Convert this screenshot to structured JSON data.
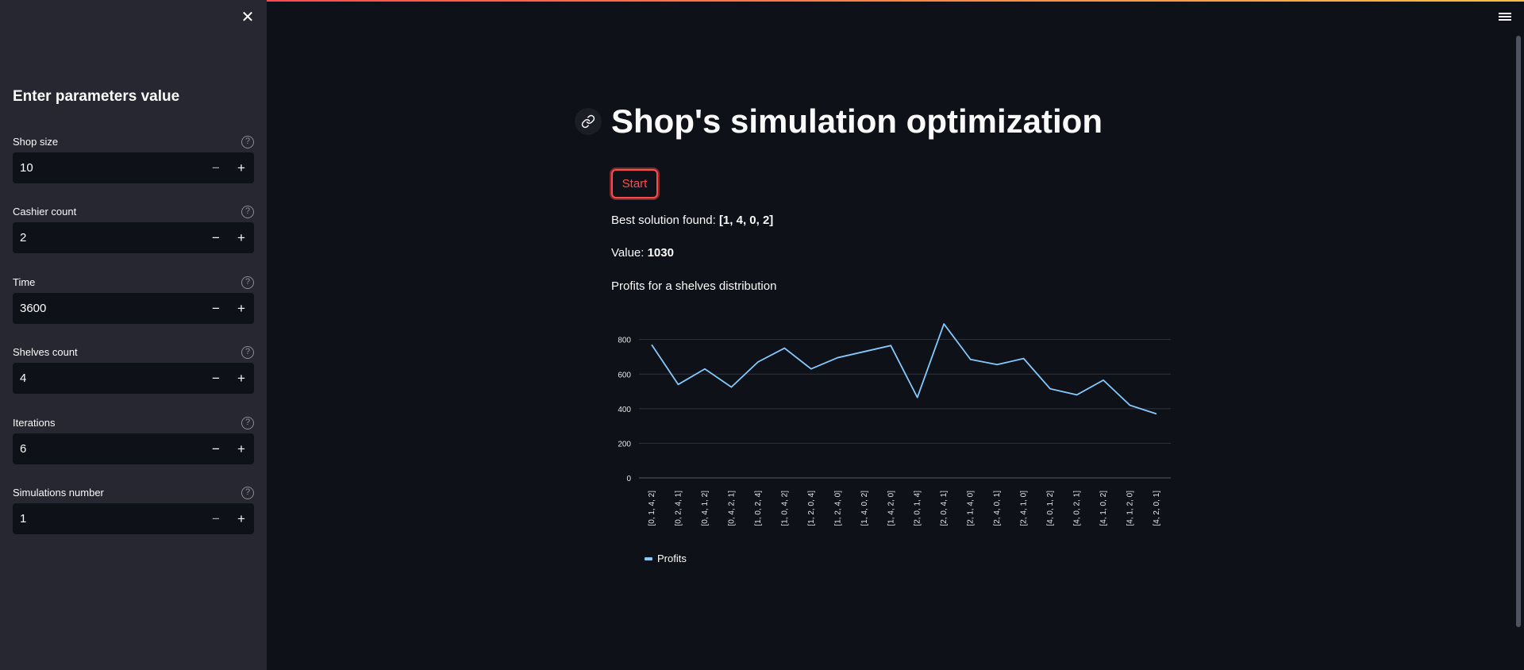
{
  "sidebar": {
    "title": "Enter parameters value",
    "params": [
      {
        "label": "Shop size",
        "value": "10"
      },
      {
        "label": "Cashier count",
        "value": "2"
      },
      {
        "label": "Time",
        "value": "3600"
      },
      {
        "label": "Shelves count",
        "value": "4"
      },
      {
        "label": "Iterations",
        "value": "6"
      },
      {
        "label": "Simulations number",
        "value": "1"
      }
    ]
  },
  "icons": {
    "close": "close-icon",
    "help": "question-circle-icon",
    "minus": "minus-icon",
    "plus": "plus-icon",
    "menu": "hamburger-menu-icon",
    "link": "link-icon"
  },
  "main": {
    "title": "Shop's simulation optimization",
    "start_label": "Start",
    "best_solution_prefix": "Best solution found: ",
    "best_solution_value": "[1, 4, 0, 2]",
    "value_prefix": "Value: ",
    "value_value": "1030",
    "chart_caption": "Profits for a shelves distribution"
  },
  "colors": {
    "accent": "#ff4b4b",
    "series": "#83c9ff",
    "background": "#0e1117",
    "sidebar": "#262730"
  },
  "chart_data": {
    "type": "line",
    "categories": [
      "[0, 1, 4, 2]",
      "[0, 2, 4, 1]",
      "[0, 4, 1, 2]",
      "[0, 4, 2, 1]",
      "[1, 0, 2, 4]",
      "[1, 0, 4, 2]",
      "[1, 2, 0, 4]",
      "[1, 2, 4, 0]",
      "[1, 4, 0, 2]",
      "[1, 4, 2, 0]",
      "[2, 0, 1, 4]",
      "[2, 0, 4, 1]",
      "[2, 1, 4, 0]",
      "[2, 4, 0, 1]",
      "[2, 4, 1, 0]",
      "[4, 0, 1, 2]",
      "[4, 0, 2, 1]",
      "[4, 1, 0, 2]",
      "[4, 1, 2, 0]",
      "[4, 2, 0, 1]"
    ],
    "series": [
      {
        "name": "Profits",
        "values": [
          770,
          540,
          630,
          525,
          670,
          750,
          630,
          695,
          730,
          765,
          465,
          890,
          685,
          655,
          690,
          515,
          480,
          565,
          420,
          370
        ]
      }
    ],
    "yticks": [
      0,
      200,
      400,
      600,
      800
    ],
    "ylim": [
      0,
      950
    ],
    "grid": true,
    "legend": "bottom-left",
    "title": "",
    "xlabel": "",
    "ylabel": ""
  }
}
